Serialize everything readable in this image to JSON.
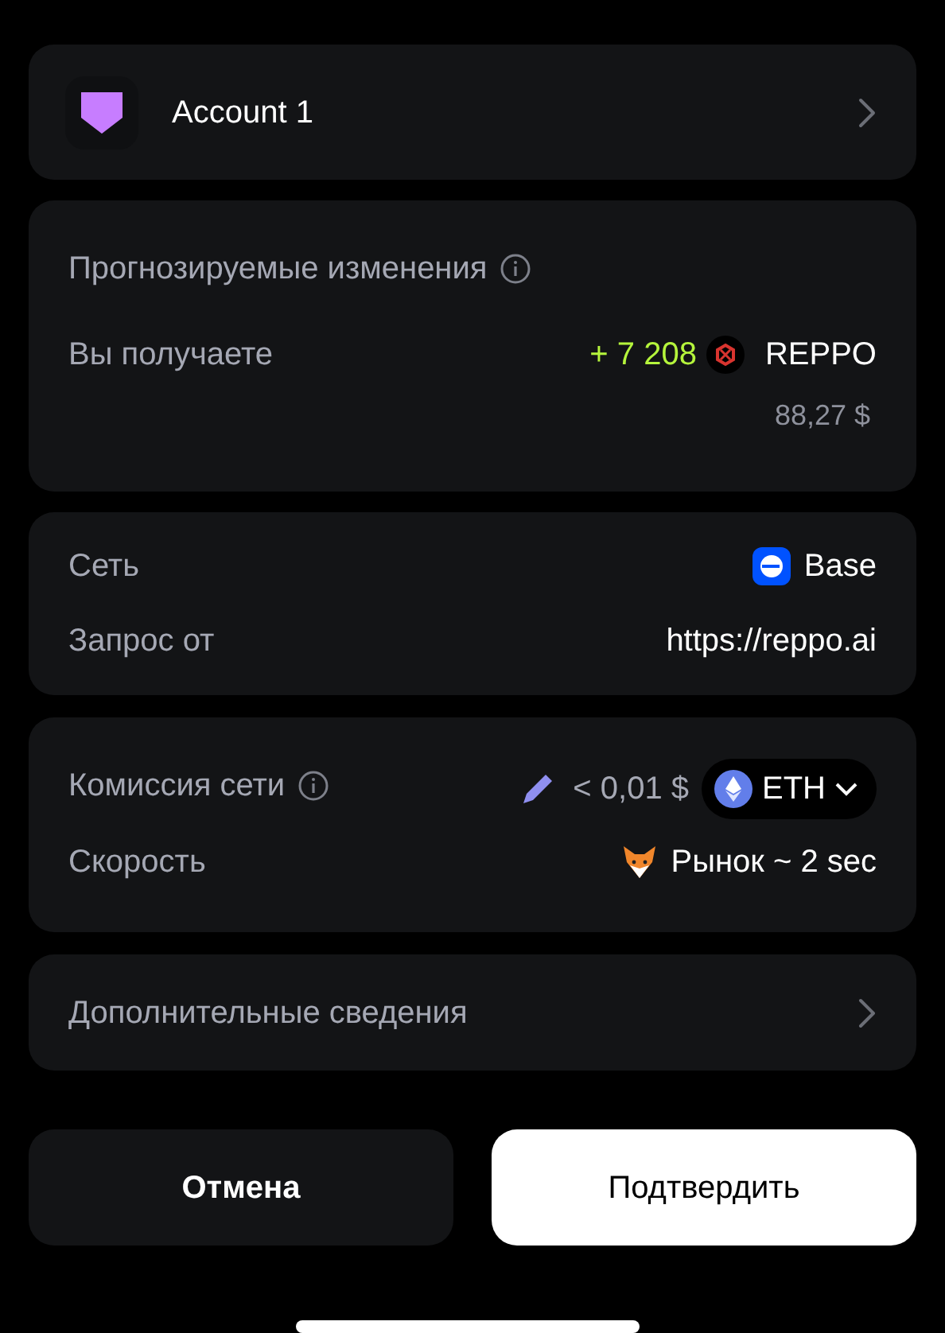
{
  "account": {
    "name": "Account 1"
  },
  "changes": {
    "title": "Прогнозируемые изменения",
    "label": "Вы получаете",
    "amount": "+ 7 208",
    "token": "REPPO",
    "fiat": "88,27 $"
  },
  "details": [
    {
      "label": "Сеть",
      "value": "Base",
      "kind": "network"
    },
    {
      "label": "Запрос от",
      "value": "https://reppo.ai",
      "kind": "plain"
    }
  ],
  "fee": {
    "label": "Комиссия сети",
    "value": "< 0,01 $",
    "token": "ETH",
    "speed_label": "Скорость",
    "speed": "Рынок ~ 2 sec"
  },
  "more": {
    "label": "Дополнительные сведения"
  },
  "buttons": [
    {
      "label": "Отмена",
      "kind": "secondary"
    },
    {
      "label": "Подтвердить",
      "kind": "primary"
    }
  ]
}
